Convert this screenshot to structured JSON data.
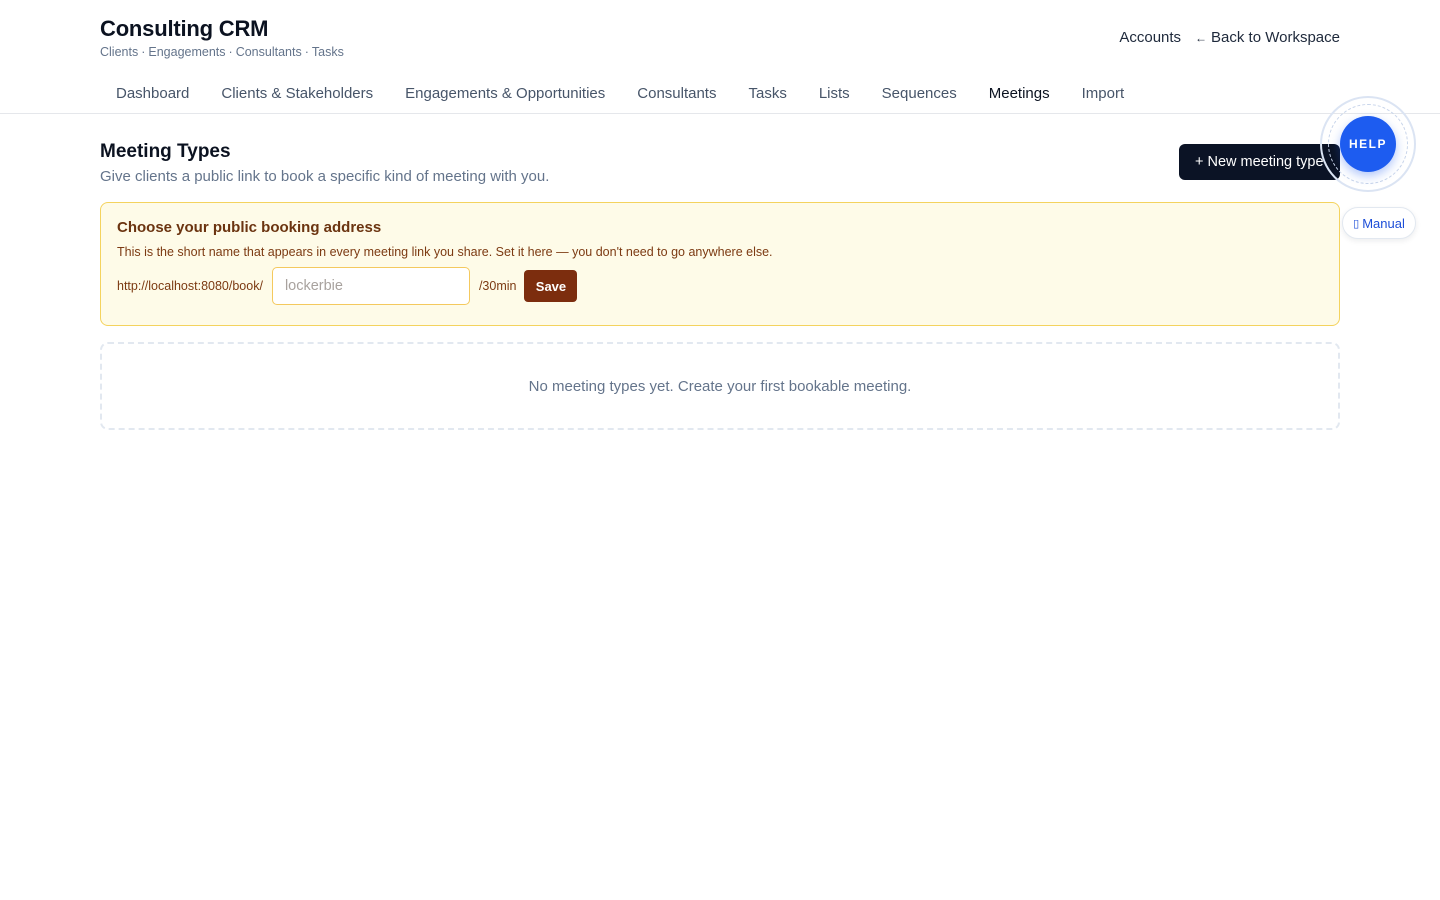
{
  "app": {
    "title": "Consulting CRM",
    "subtitle_parts": [
      "Clients",
      "Engagements",
      "Consultants",
      "Tasks"
    ],
    "subtitle_separator": "·"
  },
  "top_links": {
    "accounts": "Accounts",
    "back_arrow": "←",
    "back": "Back to Workspace"
  },
  "nav": {
    "tabs": [
      {
        "label": "Dashboard"
      },
      {
        "label": "Clients & Stakeholders"
      },
      {
        "label": "Engagements & Opportunities"
      },
      {
        "label": "Consultants"
      },
      {
        "label": "Tasks"
      },
      {
        "label": "Lists"
      },
      {
        "label": "Sequences"
      },
      {
        "label": "Meetings",
        "active": true
      },
      {
        "label": "Import"
      }
    ]
  },
  "section": {
    "title": "Meeting Types",
    "description": "Give clients a public link to book a specific kind of meeting with you.",
    "new_button": "+ New meeting type"
  },
  "help": {
    "label": "HELP",
    "manual_icon": "book-icon",
    "manual_label": "Manual"
  },
  "booking": {
    "title": "Choose your public booking address",
    "description": "This is the short name that appears in every meeting link you share. Set it here — you don't need to go anywhere else.",
    "url_prefix": "http://localhost:8080/book/",
    "slug_value": "",
    "slug_placeholder": "lockerbie",
    "url_suffix": "/30min",
    "save_label": "Save"
  },
  "empty_state": {
    "message": "No meeting types yet. Create your first bookable meeting."
  },
  "colors": {
    "primary_dark": "#0b1325",
    "help_blue": "#1d5cf0",
    "notice_bg": "#fefbe8",
    "notice_border": "#f4d35e",
    "save_brown": "#7c2d0e"
  }
}
